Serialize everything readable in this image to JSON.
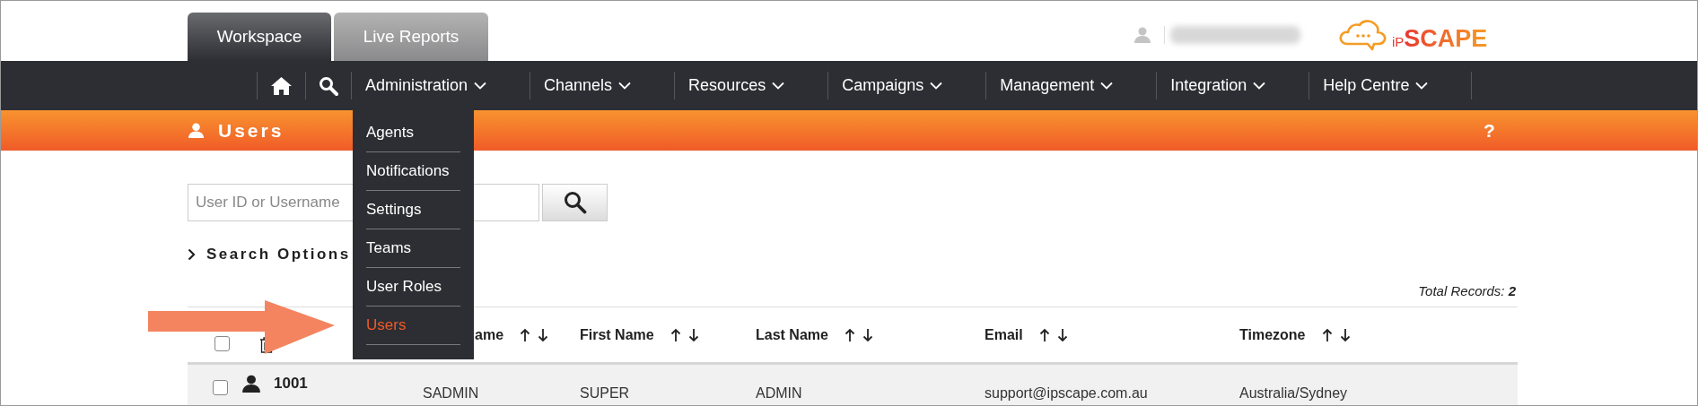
{
  "tabs": [
    {
      "label": "Workspace",
      "selected": true
    },
    {
      "label": "Live Reports",
      "selected": false
    }
  ],
  "logo": {
    "prefix": "iP",
    "name": "SCAPE"
  },
  "nav": [
    {
      "kind": "home"
    },
    {
      "kind": "search"
    },
    {
      "kind": "menu",
      "label": "Administration"
    },
    {
      "kind": "menu",
      "label": "Channels"
    },
    {
      "kind": "menu",
      "label": "Resources"
    },
    {
      "kind": "menu",
      "label": "Campaigns"
    },
    {
      "kind": "menu",
      "label": "Management"
    },
    {
      "kind": "menu",
      "label": "Integration"
    },
    {
      "kind": "menu",
      "label": "Help Centre"
    }
  ],
  "dropdown": [
    {
      "label": "Agents",
      "selected": false
    },
    {
      "label": "Notifications",
      "selected": false
    },
    {
      "label": "Settings",
      "selected": false
    },
    {
      "label": "Teams",
      "selected": false
    },
    {
      "label": "User Roles",
      "selected": false
    },
    {
      "label": "Users",
      "selected": true
    }
  ],
  "page_title": "Users",
  "help": "?",
  "search": {
    "placeholder": "User ID or Username"
  },
  "search_options": "Search Options",
  "total_records": {
    "label": "Total Records:",
    "value": "2"
  },
  "table": {
    "select_all": {
      "checked": false
    },
    "columns": [
      "ame",
      "First Name",
      "Last Name",
      "Email",
      "Timezone"
    ],
    "rows": [
      {
        "checked": false,
        "id": "1001",
        "cells": [
          "SADMIN",
          "SUPER",
          "ADMIN",
          "support@ipscape.com.au",
          "Australia/Sydney"
        ]
      }
    ]
  }
}
